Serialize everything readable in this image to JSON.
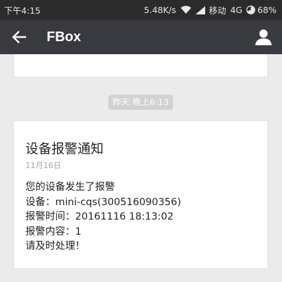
{
  "status_bar": {
    "time": "下午4:15",
    "network_speed": "5.48K/s",
    "carrier": "移动",
    "network_type": "4G",
    "battery": "68%",
    "icons": [
      "wifi-icon",
      "signal-icon",
      "battery-icon"
    ]
  },
  "app_bar": {
    "title": "FBox",
    "icons": [
      "back-arrow-icon",
      "profile-icon"
    ]
  },
  "chat": {
    "timestamp": "昨天 晚上6:13",
    "message": {
      "title": "设备报警通知",
      "date": "11月16日",
      "lines": [
        "您的设备发生了报警",
        "设备：mini-cqs(300516090356)",
        "报警时间：20161116 18:13:02",
        "报警内容：1",
        "请及时处理！"
      ]
    }
  },
  "colors": {
    "status_bar_bg": "#2b2b2b",
    "app_bar_bg": "#393a3f",
    "page_bg": "#ebebeb",
    "card_bg": "#ffffff",
    "timestamp_bg": "#d2d2d2"
  }
}
